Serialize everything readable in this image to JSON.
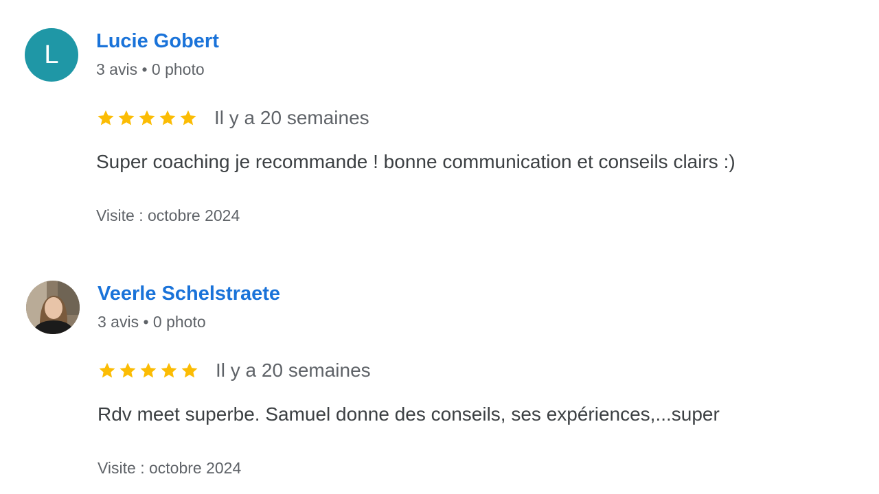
{
  "reviews": [
    {
      "author_name": "Lucie Gobert",
      "avatar_letter": "L",
      "avatar_color": "#1f97a6",
      "meta": "3 avis • 0 photo",
      "rating": 5,
      "rating_max": 5,
      "relative_date": "Il y a 20 semaines",
      "text": "Super coaching je recommande ! bonne communication et conseils clairs :)",
      "visit": "Visite : octobre 2024"
    },
    {
      "author_name": "Veerle Schelstraete",
      "avatar_type": "photo",
      "meta": "3 avis • 0 photo",
      "rating": 5,
      "rating_max": 5,
      "relative_date": "Il y a 20 semaines",
      "text": "Rdv meet superbe. Samuel donne des conseils, ses expériences,...super",
      "visit": "Visite : octobre 2024"
    }
  ],
  "colors": {
    "author_link": "#1a73d9",
    "star": "#fbbc04",
    "secondary_text": "#5f6368",
    "body_text": "#3c4043"
  },
  "icons": {
    "rating_star": "star-icon"
  }
}
